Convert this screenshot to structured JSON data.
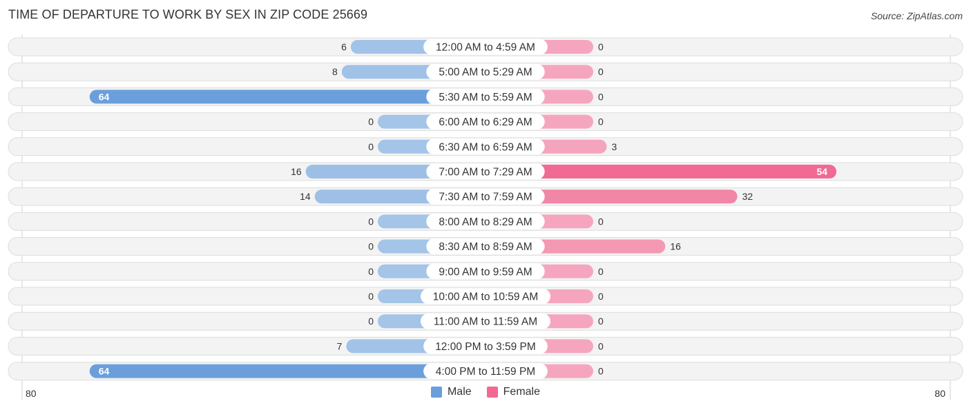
{
  "header": {
    "title": "TIME OF DEPARTURE TO WORK BY SEX IN ZIP CODE 25669",
    "source": "Source: ZipAtlas.com"
  },
  "legend": {
    "male_label": "Male",
    "female_label": "Female"
  },
  "colors": {
    "male_light": "#a4c4e8",
    "male_dark": "#6a9fdb",
    "female_light": "#f5a6be",
    "female_dark": "#f06a93",
    "row_bg": "#f3f3f3",
    "row_border": "#dddddd"
  },
  "chart_data": {
    "type": "bar",
    "orientation": "horizontal-diverging",
    "title": "TIME OF DEPARTURE TO WORK BY SEX IN ZIP CODE 25669",
    "categories": [
      "12:00 AM to 4:59 AM",
      "5:00 AM to 5:29 AM",
      "5:30 AM to 5:59 AM",
      "6:00 AM to 6:29 AM",
      "6:30 AM to 6:59 AM",
      "7:00 AM to 7:29 AM",
      "7:30 AM to 7:59 AM",
      "8:00 AM to 8:29 AM",
      "8:30 AM to 8:59 AM",
      "9:00 AM to 9:59 AM",
      "10:00 AM to 10:59 AM",
      "11:00 AM to 11:59 AM",
      "12:00 PM to 3:59 PM",
      "4:00 PM to 11:59 PM"
    ],
    "series": [
      {
        "name": "Male",
        "values": [
          6,
          8,
          64,
          0,
          0,
          16,
          14,
          0,
          0,
          0,
          0,
          0,
          7,
          64
        ]
      },
      {
        "name": "Female",
        "values": [
          0,
          0,
          0,
          0,
          3,
          54,
          32,
          0,
          16,
          0,
          0,
          0,
          0,
          0
        ]
      }
    ],
    "axis": {
      "left_label": "80",
      "right_label": "80",
      "max": 80
    },
    "legend_position": "bottom-center"
  }
}
